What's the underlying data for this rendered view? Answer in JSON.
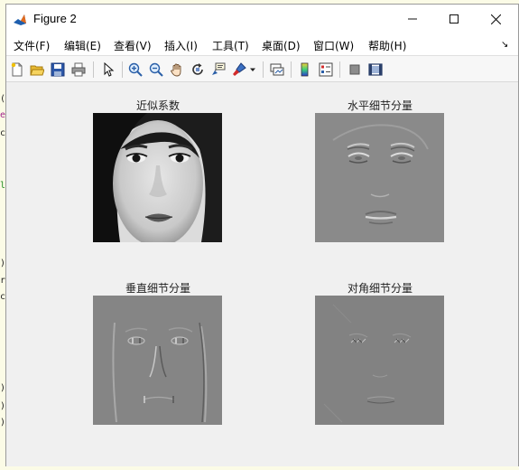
{
  "window": {
    "title": "Figure 2"
  },
  "menubar": {
    "items": [
      "文件(F)",
      "编辑(E)",
      "查看(V)",
      "插入(I)",
      "工具(T)",
      "桌面(D)",
      "窗口(W)",
      "帮助(H)"
    ]
  },
  "toolbar": {
    "icons": [
      "new-figure-icon",
      "open-file-icon",
      "save-icon",
      "print-icon",
      "select-arrow-icon",
      "zoom-in-icon",
      "zoom-out-icon",
      "pan-hand-icon",
      "rotate-3d-icon",
      "data-cursor-icon",
      "brush-icon",
      "link-plot-icon",
      "colorbar-icon",
      "legend-icon",
      "hide-plot-tools-icon",
      "show-plot-tools-icon"
    ]
  },
  "subplots": [
    {
      "title": "近似系数",
      "kind": "approximation"
    },
    {
      "title": "水平细节分量",
      "kind": "horizontal-detail"
    },
    {
      "title": "垂直细节分量",
      "kind": "vertical-detail"
    },
    {
      "title": "对角细节分量",
      "kind": "diagonal-detail"
    }
  ]
}
